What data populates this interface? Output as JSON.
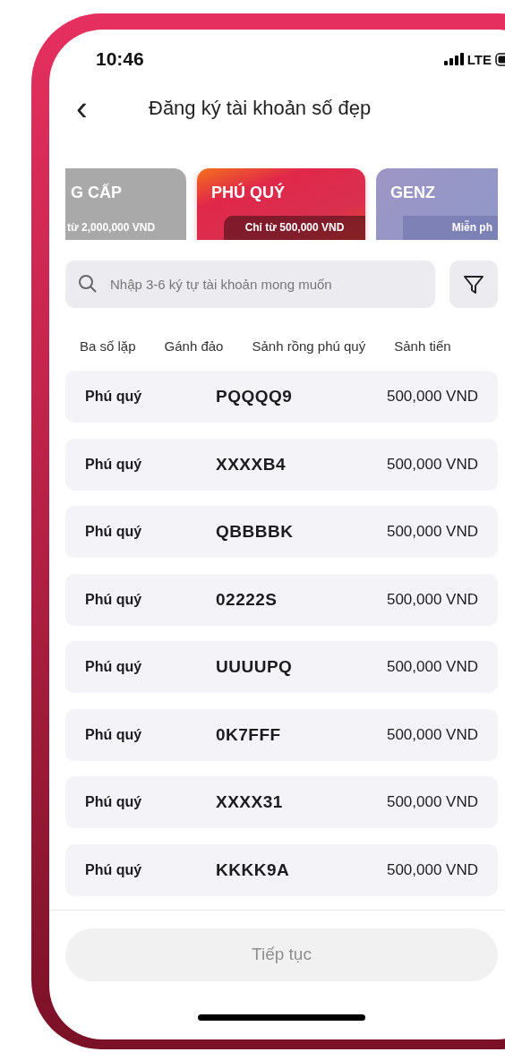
{
  "status_bar": {
    "time": "10:46",
    "network": "LTE"
  },
  "header": {
    "back": "‹",
    "title": "Đăng ký tài khoản số đẹp"
  },
  "cards": [
    {
      "kind": "silver",
      "title": "G CẤP",
      "subtitle": "từ 2,000,000 VND",
      "selected": false
    },
    {
      "kind": "ruby",
      "title": "PHÚ QUÝ",
      "subtitle": "Chỉ từ 500,000 VND",
      "selected": true
    },
    {
      "kind": "lavender",
      "title": "GENZ",
      "subtitle": "Miễn ph",
      "selected": false
    }
  ],
  "search": {
    "placeholder": "Nhập 3-6 ký tự tài khoản mong muốn"
  },
  "chips": [
    "Ba số lặp",
    "Gánh đảo",
    "Sảnh rồng phú quý",
    "Sảnh tiến"
  ],
  "rows": [
    {
      "type": "Phú quý",
      "number": "PQQQQ9",
      "price": "500,000 VND"
    },
    {
      "type": "Phú quý",
      "number": "XXXXB4",
      "price": "500,000 VND"
    },
    {
      "type": "Phú quý",
      "number": "QBBBBK",
      "price": "500,000 VND"
    },
    {
      "type": "Phú quý",
      "number": "02222S",
      "price": "500,000 VND"
    },
    {
      "type": "Phú quý",
      "number": "UUUUPQ",
      "price": "500,000 VND"
    },
    {
      "type": "Phú quý",
      "number": "0K7FFF",
      "price": "500,000 VND"
    },
    {
      "type": "Phú quý",
      "number": "XXXX31",
      "price": "500,000 VND"
    },
    {
      "type": "Phú quý",
      "number": "KKKK9A",
      "price": "500,000 VND"
    }
  ],
  "continue_button": {
    "label": "Tiếp tục",
    "disabled": true
  }
}
